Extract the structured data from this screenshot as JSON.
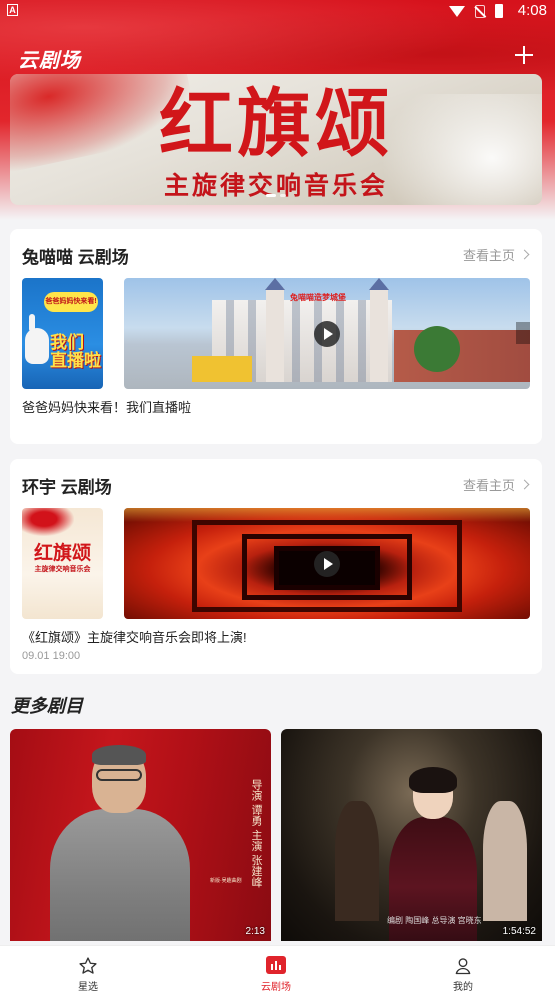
{
  "status_bar": {
    "time": "4:08",
    "notify_glyph": "A"
  },
  "header": {
    "title": "云剧场",
    "add_icon": "plus-icon"
  },
  "banner": {
    "title": "红旗颂",
    "subtitle": "主旋律交响音乐会"
  },
  "cards": [
    {
      "title": "兔喵喵 云剧场",
      "more": "查看主页",
      "thumb_bubble": "爸爸妈妈快来看!",
      "thumb_big": "我们\n直播啦",
      "video_caption": "兔喵喵造梦城堡",
      "desc": "爸爸妈妈快来看！我们直播啦",
      "time": ""
    },
    {
      "title": "环宇 云剧场",
      "more": "查看主页",
      "thumb_title": "红旗颂",
      "thumb_sub": "主旋律交响音乐会",
      "desc": "《红旗颂》主旋律交响音乐会即将上演!",
      "time": "09.01 19:00"
    }
  ],
  "more_section": {
    "title": "更多剧目"
  },
  "posters": [
    {
      "duration": "2:13",
      "credits": "导演 谭勇 主演 张建峰",
      "footer": "新版·吴趣曲剧"
    },
    {
      "duration": "1:54:52",
      "credits": "编剧 陶国峰 总导演 宫晓东"
    }
  ],
  "bottom_nav": [
    {
      "label": "星选",
      "icon": "star-icon",
      "active": false
    },
    {
      "label": "云剧场",
      "icon": "chart-icon",
      "active": true
    },
    {
      "label": "我的",
      "icon": "user-icon",
      "active": false
    }
  ],
  "colors": {
    "brand_red": "#e0242c",
    "banner_red": "#d1161a"
  }
}
